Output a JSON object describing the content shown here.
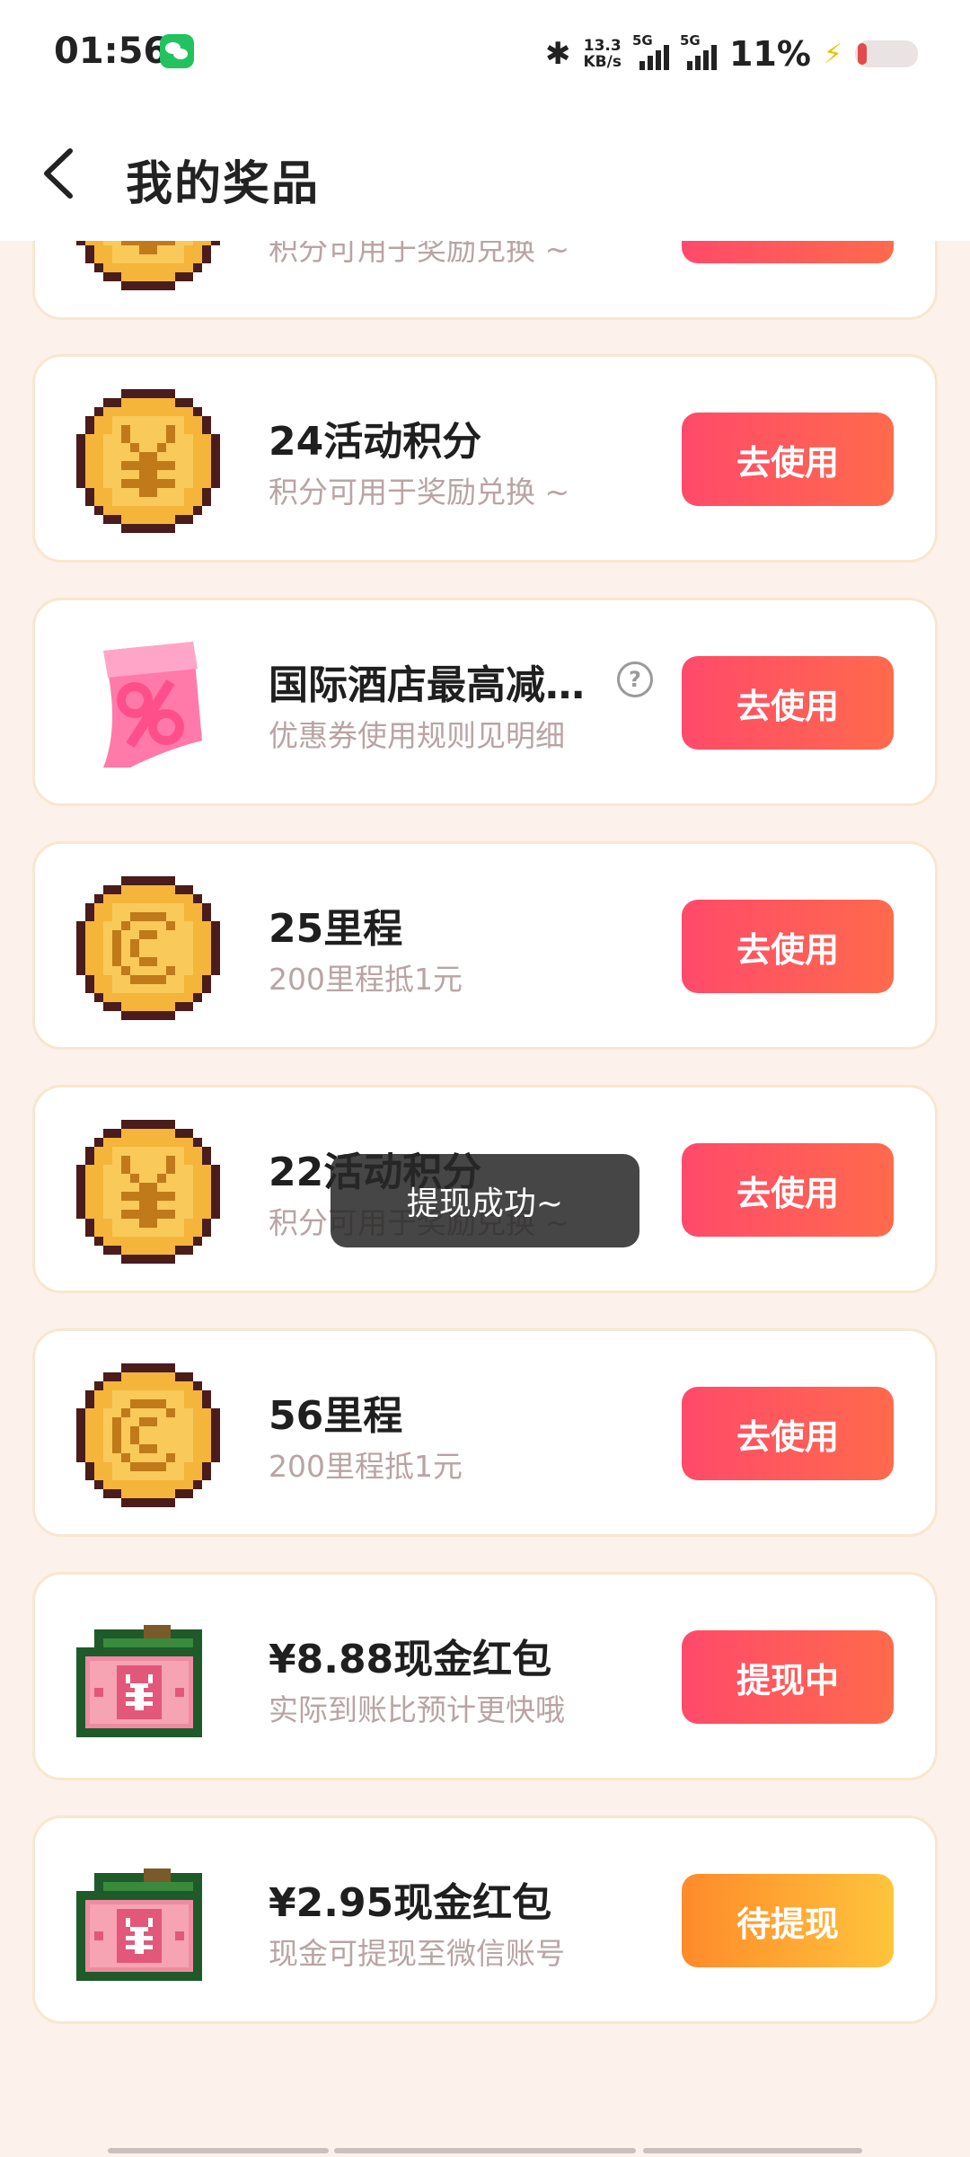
{
  "status_bar": {
    "time": "01:56",
    "net_speed_value": "13.3",
    "net_speed_unit": "KB/s",
    "signal1_label": "5G",
    "signal2_label": "5G",
    "battery_percent": "11%"
  },
  "header": {
    "title": "我的奖品"
  },
  "prizes": [
    {
      "name": "",
      "desc": "积分可用于奖励兑换 ~",
      "button": "",
      "icon": "coin-yen-icon"
    },
    {
      "name": "24活动积分",
      "desc": "积分可用于奖励兑换 ~",
      "button": "去使用",
      "icon": "coin-yen-icon"
    },
    {
      "name": "国际酒店最高减…",
      "desc": "优惠券使用规则见明细",
      "button": "去使用",
      "icon": "coupon-ticket-icon"
    },
    {
      "name": "25里程",
      "desc": "200里程抵1元",
      "button": "去使用",
      "icon": "coin-c-icon"
    },
    {
      "name": "22活动积分",
      "desc": "积分可用于奖励兑换 ~",
      "button": "去使用",
      "icon": "coin-yen-icon"
    },
    {
      "name": "56里程",
      "desc": "200里程抵1元",
      "button": "去使用",
      "icon": "coin-c-icon"
    },
    {
      "name": "¥8.88现金红包",
      "desc": "实际到账比预计更快哦",
      "button": "提现中",
      "icon": "cash-bills-icon"
    },
    {
      "name": "¥2.95现金红包",
      "desc": "现金可提现至微信账号",
      "button": "待提现",
      "icon": "cash-bills-icon"
    }
  ],
  "help_glyph": "?",
  "toast": "提现成功~",
  "colors": {
    "primary_button": "#ff4a6a",
    "pending_button": "#ff8a2a",
    "background": "#fdf1ec"
  }
}
